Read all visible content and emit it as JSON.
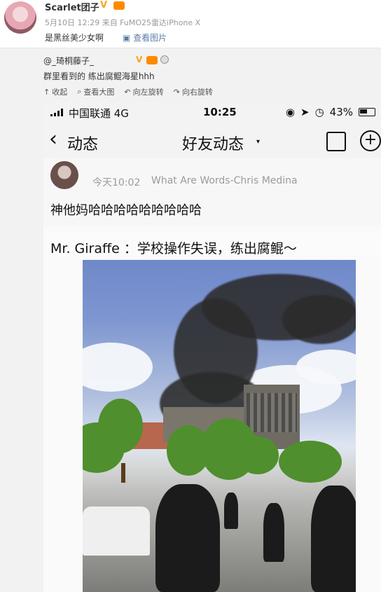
{
  "top": {
    "username": "Scarlet团子",
    "vip_badge": "V",
    "meta": "5月10日 12:29 来自 FuMO25雷达iPhone X",
    "text": "是黑丝美少女啊",
    "view_image": "查看图片"
  },
  "repost": {
    "user": "@_琦桐藤子_",
    "vip_badge": "V",
    "text": "群里看到的 练出腐鲲海星hhh",
    "actions": [
      {
        "label": "收起",
        "icon": "collapse-icon"
      },
      {
        "label": "查看大图",
        "icon": "zoom-icon"
      },
      {
        "label": "向左旋转",
        "icon": "rotate-left-icon"
      },
      {
        "label": "向右旋转",
        "icon": "rotate-right-icon"
      }
    ]
  },
  "phone": {
    "carrier": "中国联通  4G",
    "time": "10:25",
    "battery": "43%",
    "back_label": "动态",
    "title": "好友动态",
    "caret": "▾"
  },
  "post": {
    "meta_time": "今天10:02",
    "song": "What Are Words-Chris Medina",
    "text": "神他妈哈哈哈哈哈哈哈哈哈"
  },
  "comment": {
    "text": "Mr. Giraffe ：学校操作失误，练出腐鲲～"
  }
}
